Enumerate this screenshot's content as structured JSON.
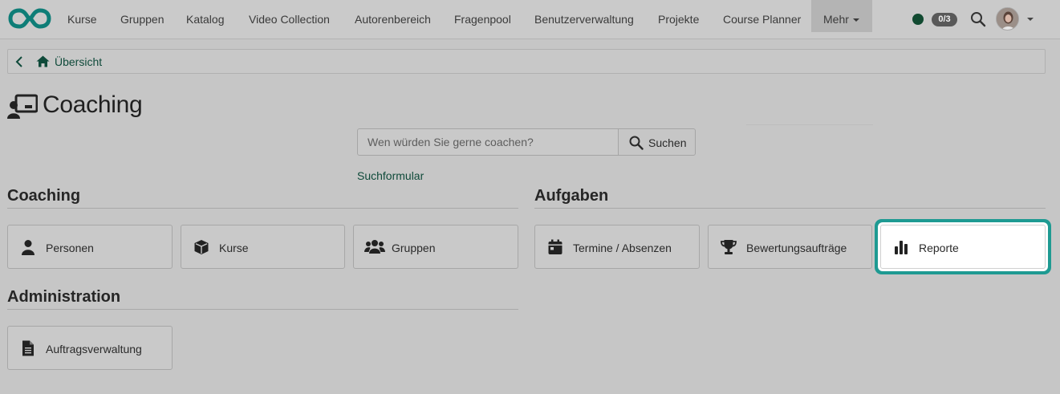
{
  "nav": {
    "items": [
      "Kurse",
      "Gruppen",
      "Katalog",
      "Video Collection",
      "Autorenbereich",
      "Fragenpool",
      "Benutzerverwaltung",
      "Projekte",
      "Course Planner"
    ],
    "more_label": "Mehr",
    "badge": "0/3"
  },
  "breadcrumb": {
    "label": "Übersicht"
  },
  "page": {
    "title": "Coaching"
  },
  "search": {
    "placeholder": "Wen würden Sie gerne coachen?",
    "button_label": "Suchen",
    "advanced_link": "Suchformular"
  },
  "sections": {
    "coaching": {
      "title": "Coaching",
      "tiles": [
        "Personen",
        "Kurse",
        "Gruppen"
      ]
    },
    "aufgaben": {
      "title": "Aufgaben",
      "tiles": [
        "Termine / Absenzen",
        "Bewertungsaufträge",
        "Reporte"
      ]
    },
    "administration": {
      "title": "Administration",
      "tiles": [
        "Auftragsverwaltung"
      ]
    }
  },
  "colors": {
    "accent": "#0f4a3a",
    "highlight_ring": "#1e9a92",
    "status_online": "#114a31"
  },
  "icons": {
    "logo": "infinity-logo",
    "search": "search-icon",
    "back": "chevron-left-icon",
    "home": "home-icon",
    "title": "coaching-icon"
  }
}
